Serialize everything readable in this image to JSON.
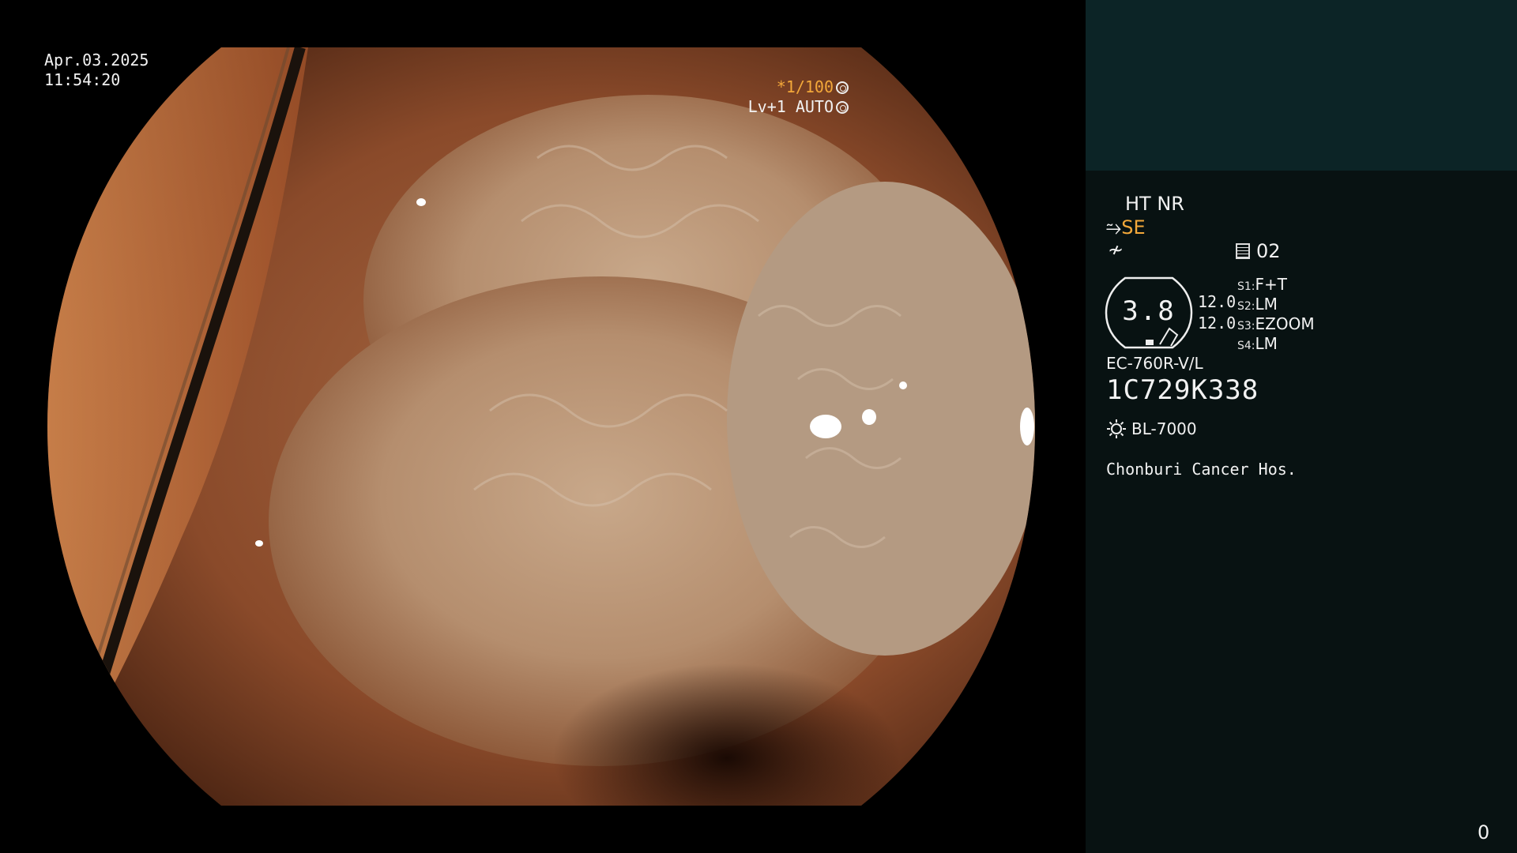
{
  "overlay": {
    "date": "Apr.03.2025",
    "time": "11:54:20",
    "shutter_prefix": "*",
    "shutter_speed": "1/100",
    "level": "Lv+1 AUTO"
  },
  "panel": {
    "modes": "HT NR",
    "structure_mode": "SE",
    "record_number": "02",
    "zoom_value": "3.8",
    "param_a": "12.0",
    "param_b": "12.0",
    "switches": [
      {
        "key": "S1:",
        "value": "F+T"
      },
      {
        "key": "S2:",
        "value": "LM"
      },
      {
        "key": "S3:",
        "value": "EZOOM"
      },
      {
        "key": "S4:",
        "value": "LM"
      }
    ],
    "scope_model": "EC-760R-V/L",
    "serial_number": "1C729K338",
    "light_source": "BL-7000",
    "hospital": "Chonburi Cancer Hos.",
    "frame_counter": "0"
  },
  "colors": {
    "panel_bg": "#081212",
    "panel_top_bg": "#0c2426",
    "accent_yellow": "#f3a83a"
  },
  "icons": [
    "shutter-icon",
    "auto-iris-icon",
    "structure-enhance-icon",
    "curve-icon",
    "record-icon",
    "zoom-badge-icon",
    "light-source-icon"
  ]
}
